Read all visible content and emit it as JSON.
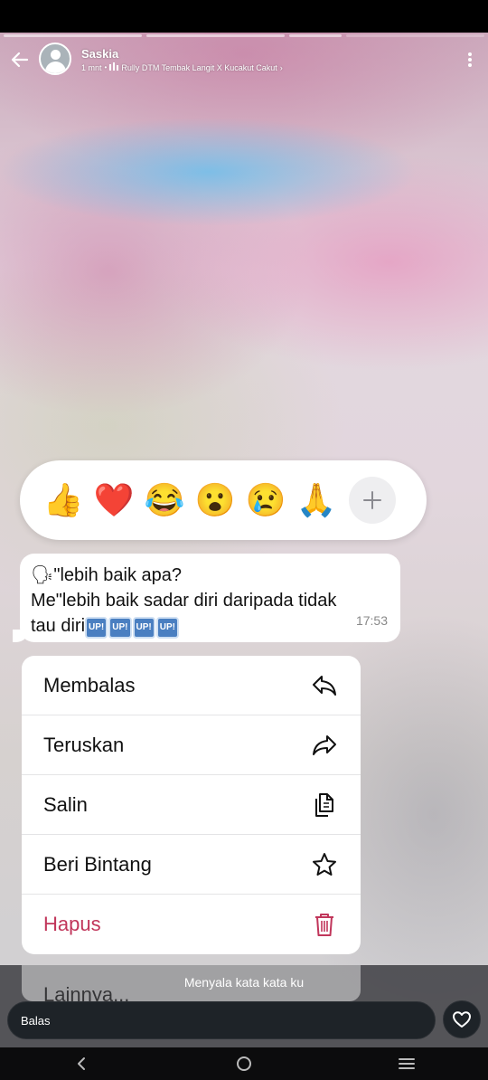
{
  "header": {
    "user_name": "Saskia",
    "time_ago": "1 mnt",
    "separator": "•",
    "music_title": "Rully DTM Tembak Langit X Kucakut Cakut",
    "music_chevron": "›"
  },
  "story_progress": {
    "segments_total": 4,
    "segments_seen": 3
  },
  "reactions": {
    "items": [
      {
        "name": "thumbs-up",
        "glyph": "👍"
      },
      {
        "name": "red-heart",
        "glyph": "❤️"
      },
      {
        "name": "tears-of-joy",
        "glyph": "😂"
      },
      {
        "name": "surprised",
        "glyph": "😮"
      },
      {
        "name": "crying",
        "glyph": "😢"
      },
      {
        "name": "folded-hands",
        "glyph": "🙏"
      }
    ],
    "more_icon": "plus-icon"
  },
  "message": {
    "speaker_glyph": "🗣",
    "line1": "\"lebih baik apa?",
    "line2": "Me\"lebih baik sadar diri daripada tidak",
    "line3": "tau diri",
    "badges": [
      "UP!",
      "UP!",
      "UP!",
      "UP!"
    ],
    "time": "17:53"
  },
  "context_menu": {
    "items": [
      {
        "label": "Membalas",
        "icon": "reply-icon"
      },
      {
        "label": "Teruskan",
        "icon": "forward-icon"
      },
      {
        "label": "Salin",
        "icon": "copy-icon"
      },
      {
        "label": "Beri Bintang",
        "icon": "star-icon"
      },
      {
        "label": "Hapus",
        "icon": "trash-icon",
        "color": "#c1365b"
      }
    ],
    "more_label": "Lainnya..."
  },
  "story_caption": "Menyala kata kata ku",
  "reply_bar": {
    "placeholder": "Balas",
    "like_icon": "heart-icon"
  },
  "system_nav": {
    "back": "back-icon",
    "home": "home-icon",
    "recents": "menu-icon"
  }
}
